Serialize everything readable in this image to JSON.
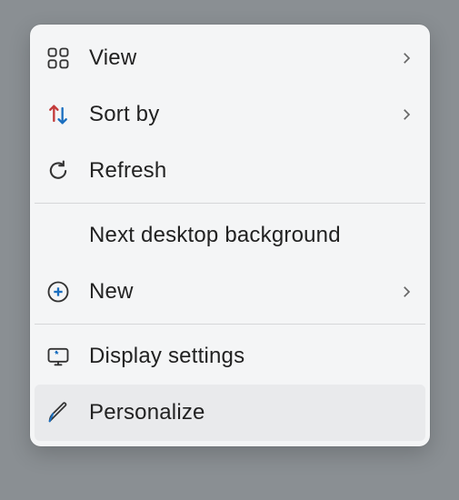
{
  "menu": {
    "view": {
      "label": "View",
      "has_submenu": true
    },
    "sort_by": {
      "label": "Sort by",
      "has_submenu": true
    },
    "refresh": {
      "label": "Refresh",
      "has_submenu": false
    },
    "next_bg": {
      "label": "Next desktop background",
      "has_submenu": false
    },
    "new": {
      "label": "New",
      "has_submenu": true
    },
    "display_settings": {
      "label": "Display settings",
      "has_submenu": false
    },
    "personalize": {
      "label": "Personalize",
      "has_submenu": false
    }
  }
}
